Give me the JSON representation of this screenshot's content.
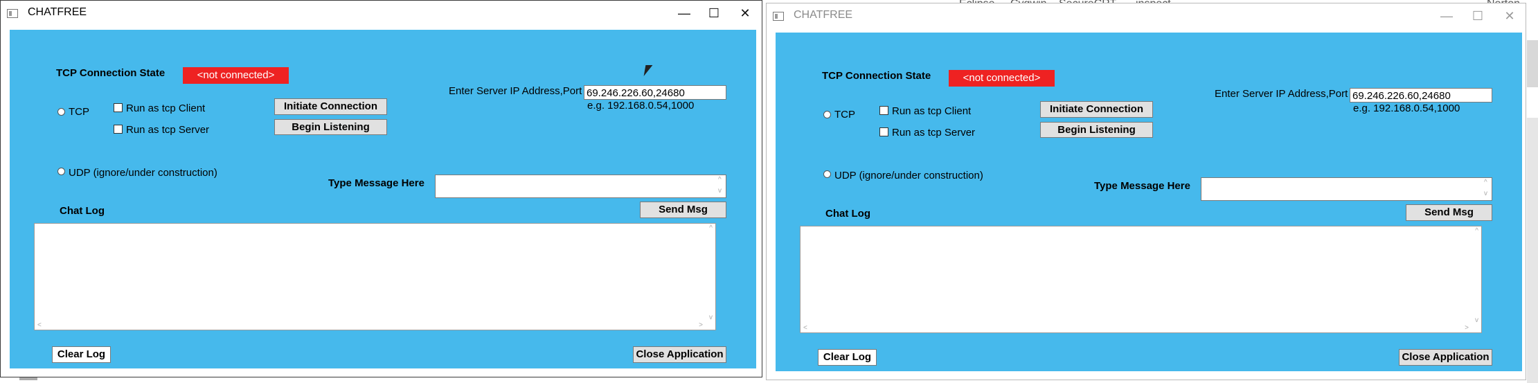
{
  "desktop": {
    "labels": [
      "Eclipse",
      "Cygwin",
      "SecureCRT",
      "inspect",
      "Norton"
    ]
  },
  "windows": [
    {
      "title": "CHATFREE",
      "minimize_icon": "minimize-icon",
      "maximize_icon": "maximize-icon",
      "close_icon": "close-icon",
      "connection_state_label": "TCP Connection State",
      "connection_state_value": "<not connected>",
      "tcp_label": "TCP",
      "run_client_label": "Run as tcp Client",
      "run_server_label": "Run as tcp Server",
      "initiate_label": "Initiate Connection",
      "listen_label": "Begin Listening",
      "server_ip_label": "Enter Server IP Address,Port",
      "server_ip_value": "69.246.226.60,24680",
      "server_ip_example": "e.g. 192.168.0.54,1000",
      "udp_label": "UDP (ignore/under construction)",
      "type_message_label": "Type Message Here",
      "message_value": "",
      "send_label": "Send Msg",
      "chat_log_label": "Chat Log",
      "chat_log_value": "",
      "clear_log_label": "Clear Log",
      "close_app_label": "Close Application"
    },
    {
      "title": "CHATFREE",
      "minimize_icon": "minimize-icon",
      "maximize_icon": "maximize-icon",
      "close_icon": "close-icon",
      "connection_state_label": "TCP Connection State",
      "connection_state_value": "<not connected>",
      "tcp_label": "TCP",
      "run_client_label": "Run as tcp Client",
      "run_server_label": "Run as tcp Server",
      "initiate_label": "Initiate Connection",
      "listen_label": "Begin Listening",
      "server_ip_label": "Enter Server IP Address,Port",
      "server_ip_value": "69.246.226.60,24680",
      "server_ip_example": "e.g. 192.168.0.54,1000",
      "udp_label": "UDP (ignore/under construction)",
      "type_message_label": "Type Message Here",
      "message_value": "",
      "send_label": "Send Msg",
      "chat_log_label": "Chat Log",
      "chat_log_value": "",
      "clear_log_label": "Clear Log",
      "close_app_label": "Close Application"
    }
  ],
  "colors": {
    "client_background": "#46b9ec",
    "status_badge": "#ee2222",
    "desktop": "#ffffff"
  }
}
